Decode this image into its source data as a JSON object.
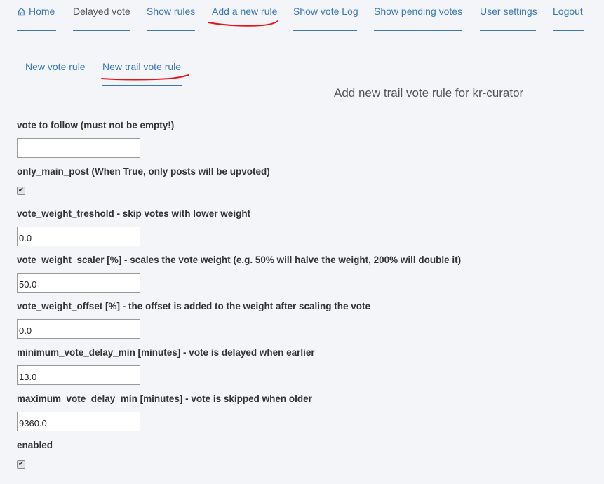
{
  "nav": {
    "home": "Home",
    "delayed_vote": "Delayed vote",
    "show_rules": "Show rules",
    "add_rule": "Add a new rule",
    "vote_log": "Show vote Log",
    "pending_votes": "Show pending votes",
    "user_settings": "User settings",
    "logout": "Logout"
  },
  "subnav": {
    "new_vote_rule": "New vote rule",
    "new_trail_vote_rule": "New trail vote rule"
  },
  "page_title": "Add new trail vote rule for kr-curator",
  "form": {
    "vote_to_follow": {
      "label": "vote to follow (must not be empty!)",
      "value": ""
    },
    "only_main_post": {
      "label": "only_main_post (When True, only posts will be upvoted)",
      "checked": true
    },
    "vote_weight_treshold": {
      "label": "vote_weight_treshold - skip votes with lower weight",
      "value": "0.0"
    },
    "vote_weight_scaler": {
      "label": "vote_weight_scaler [%] - scales the vote weight (e.g. 50% will halve the weight, 200% will double it)",
      "value": "50.0"
    },
    "vote_weight_offset": {
      "label": "vote_weight_offset [%] - the offset is added to the weight after scaling the vote",
      "value": "0.0"
    },
    "minimum_vote_delay_min": {
      "label": "minimum_vote_delay_min [minutes] - vote is delayed when earlier",
      "value": "13.0"
    },
    "maximum_vote_delay_min": {
      "label": "maximum_vote_delay_min [minutes] - vote is skipped when older",
      "value": "9360.0"
    },
    "enabled": {
      "label": "enabled",
      "checked": true
    }
  },
  "icons": {
    "home": "home-icon",
    "check": "check-icon"
  },
  "colors": {
    "link": "#3a78b5",
    "annotation": "#e8131a",
    "background": "#f4f5f9"
  }
}
